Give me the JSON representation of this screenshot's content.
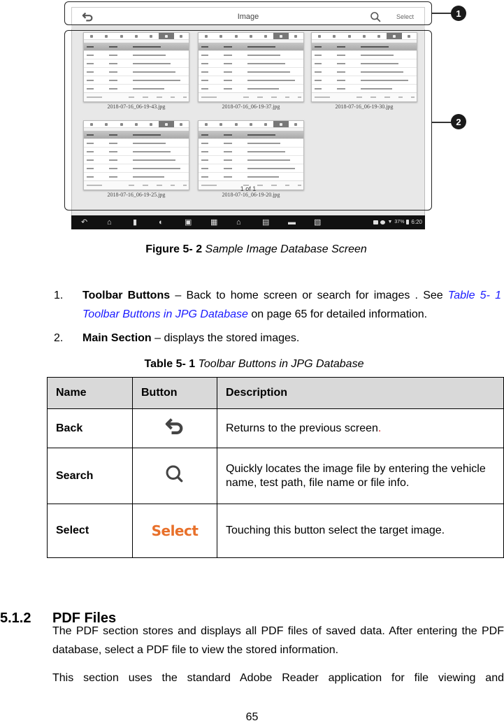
{
  "figure": {
    "callouts": [
      "1",
      "2"
    ],
    "app": {
      "toolbar": {
        "back_icon": "back-arrow-icon",
        "title": "Image",
        "search_icon": "search-icon",
        "select_label": "Select"
      },
      "images": [
        "2018-07-16_06-19-43.jpg",
        "2018-07-16_06-19-37.jpg",
        "2018-07-16_06-19-30.jpg",
        "2018-07-16_06-19-25.jpg",
        "2018-07-16_06-19-20.jpg"
      ],
      "pager": "1 of 1",
      "navbar": {
        "icons": [
          "back-icon",
          "home-icon",
          "recent-apps-icon",
          "browser-icon",
          "camera-icon",
          "vci-icon",
          "house-icon",
          "vcmi-icon",
          "car-icon",
          "remote-support-icon"
        ],
        "status": {
          "battery": "37%",
          "time": "6:20"
        }
      }
    },
    "caption": {
      "label": "Figure 5- 2",
      "title": "Sample Image Database Screen"
    }
  },
  "list": [
    {
      "num": "1.",
      "bold": "Toolbar Buttons",
      "text_before": " – Back to home screen or search for images . See ",
      "link": "Table 5- 1 Toolbar Buttons in JPG Database",
      "text_after": " on page 65 for detailed information."
    },
    {
      "num": "2.",
      "bold": "Main Section",
      "text_before": " – displays the stored images."
    }
  ],
  "table": {
    "caption": {
      "label": "Table 5- 1",
      "title": "Toolbar Buttons in JPG Database"
    },
    "headers": [
      "Name",
      "Button",
      "Description"
    ],
    "rows": [
      {
        "name": "Back",
        "button_icon": "back-arrow-icon",
        "description": "Returns to the previous screen",
        "trailing": "."
      },
      {
        "name": "Search",
        "button_icon": "search-icon",
        "description": "Quickly locates the image file by entering the vehicle name, test path, file name or file info."
      },
      {
        "name": "Select",
        "button_label": "Select",
        "description": "Touching this button select the target image."
      }
    ]
  },
  "section": {
    "number": "5.1.2",
    "title": "PDF Files",
    "paragraphs": [
      "The PDF section stores and displays all PDF files of saved data. After entering the PDF database, select a PDF file to view the stored information.",
      "This section uses the standard Adobe Reader application for file viewing and"
    ]
  },
  "page_number": "65",
  "colors": {
    "link": "#1a1aff",
    "select_orange": "#e8702a",
    "header_gray": "#d9d9d9"
  }
}
